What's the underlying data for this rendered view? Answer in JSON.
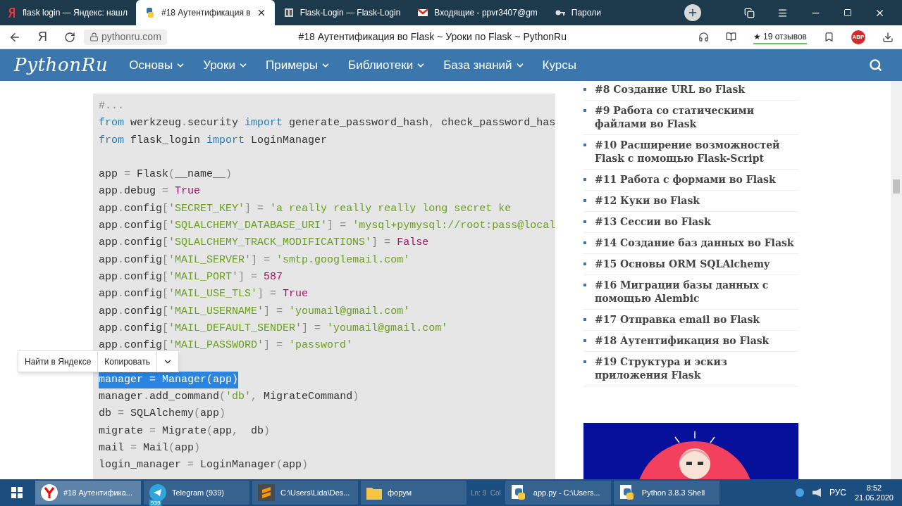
{
  "tabs": [
    {
      "label": "flask login — Яндекс: нашл",
      "selected": false,
      "kind": "yandex"
    },
    {
      "label": "#18 Аутентификация в",
      "selected": true,
      "kind": "python"
    },
    {
      "label": "Flask-Login — Flask-Login",
      "selected": false,
      "kind": "book"
    },
    {
      "label": "Входящие - ppvr3407@gm",
      "selected": false,
      "kind": "mail"
    },
    {
      "label": "Пароли",
      "selected": false,
      "kind": "key"
    }
  ],
  "address_bar": {
    "home": "Я",
    "url": "pythonru.com",
    "page_title": "#18 Аутентификация во Flask ~ Уроки по Flask ~ PythonRu",
    "reviews": "★ 19 отзывов",
    "adblock": "ABP"
  },
  "site_nav": {
    "logo": "PythonRu",
    "items": [
      {
        "label": "Основы",
        "has_menu": true
      },
      {
        "label": "Уроки",
        "has_menu": true
      },
      {
        "label": "Примеры",
        "has_menu": true
      },
      {
        "label": "Библиотеки",
        "has_menu": true
      },
      {
        "label": "База знаний",
        "has_menu": true
      },
      {
        "label": "Курсы",
        "has_menu": false
      }
    ]
  },
  "code": [
    {
      "kind": "code",
      "selected": false,
      "tokens": [
        {
          "text": "#...",
          "kind": "comment"
        }
      ]
    },
    {
      "kind": "code",
      "selected": false,
      "tokens": [
        {
          "text": "from",
          "kind": "kw"
        },
        {
          "text": " werkzeug",
          "kind": "plain"
        },
        {
          "text": ".",
          "kind": "punct"
        },
        {
          "text": "security ",
          "kind": "plain"
        },
        {
          "text": "import",
          "kind": "kw"
        },
        {
          "text": " generate_password_hash",
          "kind": "plain"
        },
        {
          "text": ",",
          "kind": "punct"
        },
        {
          "text": " check_password_has",
          "kind": "plain"
        }
      ]
    },
    {
      "kind": "code",
      "selected": false,
      "tokens": [
        {
          "text": "from",
          "kind": "kw"
        },
        {
          "text": " flask_login ",
          "kind": "plain"
        },
        {
          "text": "import",
          "kind": "kw"
        },
        {
          "text": " LoginManager",
          "kind": "plain"
        }
      ]
    },
    {
      "kind": "blank"
    },
    {
      "kind": "code",
      "selected": false,
      "tokens": [
        {
          "text": "app ",
          "kind": "plain"
        },
        {
          "text": "=",
          "kind": "punct"
        },
        {
          "text": " Flask",
          "kind": "plain"
        },
        {
          "text": "(",
          "kind": "punct"
        },
        {
          "text": "__name__",
          "kind": "plain"
        },
        {
          "text": ")",
          "kind": "punct"
        }
      ]
    },
    {
      "kind": "code",
      "selected": false,
      "tokens": [
        {
          "text": "app",
          "kind": "plain"
        },
        {
          "text": ".",
          "kind": "punct"
        },
        {
          "text": "debug ",
          "kind": "plain"
        },
        {
          "text": "= ",
          "kind": "punct"
        },
        {
          "text": "True",
          "kind": "lit"
        }
      ]
    },
    {
      "kind": "code",
      "selected": false,
      "tokens": [
        {
          "text": "app",
          "kind": "plain"
        },
        {
          "text": ".",
          "kind": "punct"
        },
        {
          "text": "config",
          "kind": "plain"
        },
        {
          "text": "[",
          "kind": "punct"
        },
        {
          "text": "'SECRET_KEY'",
          "kind": "str"
        },
        {
          "text": "] = ",
          "kind": "punct"
        },
        {
          "text": "'a really really really long secret ke",
          "kind": "str"
        }
      ]
    },
    {
      "kind": "code",
      "selected": false,
      "tokens": [
        {
          "text": "app",
          "kind": "plain"
        },
        {
          "text": ".",
          "kind": "punct"
        },
        {
          "text": "config",
          "kind": "plain"
        },
        {
          "text": "[",
          "kind": "punct"
        },
        {
          "text": "'SQLALCHEMY_DATABASE_URI'",
          "kind": "str"
        },
        {
          "text": "] = ",
          "kind": "punct"
        },
        {
          "text": "'mysql+pymysql://root:pass@local",
          "kind": "str"
        }
      ]
    },
    {
      "kind": "code",
      "selected": false,
      "tokens": [
        {
          "text": "app",
          "kind": "plain"
        },
        {
          "text": ".",
          "kind": "punct"
        },
        {
          "text": "config",
          "kind": "plain"
        },
        {
          "text": "[",
          "kind": "punct"
        },
        {
          "text": "'SQLALCHEMY_TRACK_MODIFICATIONS'",
          "kind": "str"
        },
        {
          "text": "] = ",
          "kind": "punct"
        },
        {
          "text": "False",
          "kind": "lit"
        }
      ]
    },
    {
      "kind": "code",
      "selected": false,
      "tokens": [
        {
          "text": "app",
          "kind": "plain"
        },
        {
          "text": ".",
          "kind": "punct"
        },
        {
          "text": "config",
          "kind": "plain"
        },
        {
          "text": "[",
          "kind": "punct"
        },
        {
          "text": "'MAIL_SERVER'",
          "kind": "str"
        },
        {
          "text": "] = ",
          "kind": "punct"
        },
        {
          "text": "'smtp.googlemail.com'",
          "kind": "str"
        }
      ]
    },
    {
      "kind": "code",
      "selected": false,
      "tokens": [
        {
          "text": "app",
          "kind": "plain"
        },
        {
          "text": ".",
          "kind": "punct"
        },
        {
          "text": "config",
          "kind": "plain"
        },
        {
          "text": "[",
          "kind": "punct"
        },
        {
          "text": "'MAIL_PORT'",
          "kind": "str"
        },
        {
          "text": "] = ",
          "kind": "punct"
        },
        {
          "text": "587",
          "kind": "lit"
        }
      ]
    },
    {
      "kind": "code",
      "selected": false,
      "tokens": [
        {
          "text": "app",
          "kind": "plain"
        },
        {
          "text": ".",
          "kind": "punct"
        },
        {
          "text": "config",
          "kind": "plain"
        },
        {
          "text": "[",
          "kind": "punct"
        },
        {
          "text": "'MAIL_USE_TLS'",
          "kind": "str"
        },
        {
          "text": "] = ",
          "kind": "punct"
        },
        {
          "text": "True",
          "kind": "lit"
        }
      ]
    },
    {
      "kind": "code",
      "selected": false,
      "tokens": [
        {
          "text": "app",
          "kind": "plain"
        },
        {
          "text": ".",
          "kind": "punct"
        },
        {
          "text": "config",
          "kind": "plain"
        },
        {
          "text": "[",
          "kind": "punct"
        },
        {
          "text": "'MAIL_USERNAME'",
          "kind": "str"
        },
        {
          "text": "] = ",
          "kind": "punct"
        },
        {
          "text": "'youmail@gmail.com'",
          "kind": "str"
        }
      ]
    },
    {
      "kind": "code",
      "selected": false,
      "tokens": [
        {
          "text": "app",
          "kind": "plain"
        },
        {
          "text": ".",
          "kind": "punct"
        },
        {
          "text": "config",
          "kind": "plain"
        },
        {
          "text": "[",
          "kind": "punct"
        },
        {
          "text": "'MAIL_DEFAULT_SENDER'",
          "kind": "str"
        },
        {
          "text": "] = ",
          "kind": "punct"
        },
        {
          "text": "'youmail@gmail.com'",
          "kind": "str"
        }
      ]
    },
    {
      "kind": "code",
      "selected": false,
      "tokens": [
        {
          "text": "app",
          "kind": "plain"
        },
        {
          "text": ".",
          "kind": "punct"
        },
        {
          "text": "config",
          "kind": "plain"
        },
        {
          "text": "[",
          "kind": "punct"
        },
        {
          "text": "'MAIL_PASSWORD'",
          "kind": "str"
        },
        {
          "text": "] = ",
          "kind": "punct"
        },
        {
          "text": "'password'",
          "kind": "str"
        }
      ]
    },
    {
      "kind": "blank"
    },
    {
      "kind": "code",
      "selected": true,
      "tokens": [
        {
          "text": "manager = Manager(app)",
          "kind": "plain"
        }
      ]
    },
    {
      "kind": "code",
      "selected": false,
      "tokens": [
        {
          "text": "manager",
          "kind": "plain"
        },
        {
          "text": ".",
          "kind": "punct"
        },
        {
          "text": "add_command",
          "kind": "plain"
        },
        {
          "text": "(",
          "kind": "punct"
        },
        {
          "text": "'db'",
          "kind": "str"
        },
        {
          "text": ",",
          "kind": "punct"
        },
        {
          "text": " MigrateCommand",
          "kind": "plain"
        },
        {
          "text": ")",
          "kind": "punct"
        }
      ]
    },
    {
      "kind": "code",
      "selected": false,
      "tokens": [
        {
          "text": "db ",
          "kind": "plain"
        },
        {
          "text": "=",
          "kind": "punct"
        },
        {
          "text": " SQLAlchemy",
          "kind": "plain"
        },
        {
          "text": "(",
          "kind": "punct"
        },
        {
          "text": "app",
          "kind": "plain"
        },
        {
          "text": ")",
          "kind": "punct"
        }
      ]
    },
    {
      "kind": "code",
      "selected": false,
      "tokens": [
        {
          "text": "migrate ",
          "kind": "plain"
        },
        {
          "text": "=",
          "kind": "punct"
        },
        {
          "text": " Migrate",
          "kind": "plain"
        },
        {
          "text": "(",
          "kind": "punct"
        },
        {
          "text": "app",
          "kind": "plain"
        },
        {
          "text": ",",
          "kind": "punct"
        },
        {
          "text": "  db",
          "kind": "plain"
        },
        {
          "text": ")",
          "kind": "punct"
        }
      ]
    },
    {
      "kind": "code",
      "selected": false,
      "tokens": [
        {
          "text": "mail ",
          "kind": "plain"
        },
        {
          "text": "=",
          "kind": "punct"
        },
        {
          "text": " Mail",
          "kind": "plain"
        },
        {
          "text": "(",
          "kind": "punct"
        },
        {
          "text": "app",
          "kind": "plain"
        },
        {
          "text": ")",
          "kind": "punct"
        }
      ]
    },
    {
      "kind": "code",
      "selected": false,
      "tokens": [
        {
          "text": "login_manager ",
          "kind": "plain"
        },
        {
          "text": "=",
          "kind": "punct"
        },
        {
          "text": " LoginManager",
          "kind": "plain"
        },
        {
          "text": "(",
          "kind": "punct"
        },
        {
          "text": "app",
          "kind": "plain"
        },
        {
          "text": ")",
          "kind": "punct"
        }
      ]
    }
  ],
  "context_menu": {
    "items": [
      "Найти в Яндексе",
      "Копировать"
    ]
  },
  "sidebar": {
    "items": [
      "#8 Создание URL во Flask",
      "#9 Работа со статическими файлами во Flask",
      "#10 Расширение возможностей Flask с помощью Flask-Script",
      "#11 Работа с формами во Flask",
      "#12 Куки во Flask",
      "#13 Сессии во Flask",
      "#14 Создание баз данных во Flask",
      "#15 Основы ORM SQLAlchemy",
      "#16 Миграции базы данных с помощью Alembic",
      "#17 Отправка email во Flask",
      "#18 Аутентификация во Flask",
      "#19 Структура и эскиз приложения Flask"
    ]
  },
  "taskbar": {
    "items": [
      {
        "label": "#18 Аутентифика...",
        "selected": true,
        "kind": "yandex"
      },
      {
        "label": "Telegram (939)",
        "selected": false,
        "kind": "telegram",
        "badge": "939"
      },
      {
        "label": "C:\\Users\\Lida\\Des...",
        "selected": false,
        "kind": "sublime"
      },
      {
        "label": "форум",
        "selected": false,
        "kind": "folder"
      },
      {
        "label": "app.py - C:\\Users...",
        "selected": false,
        "kind": "python"
      },
      {
        "label": "Python 3.8.3 Shell",
        "selected": false,
        "kind": "python"
      }
    ],
    "peek_text": "Ln: 9  Col",
    "language": "РУС",
    "time": "8:52",
    "date": "21.06.2020"
  }
}
